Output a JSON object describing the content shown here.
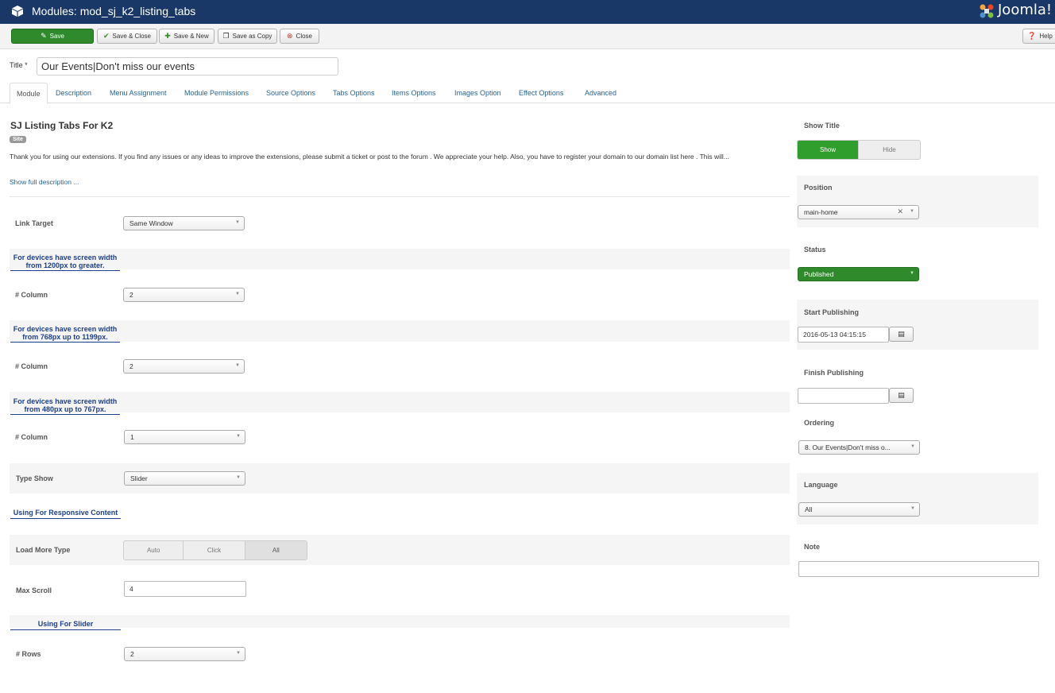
{
  "header": {
    "title": "Modules: mod_sj_k2_listing_tabs",
    "logo_text": "Joomla!"
  },
  "toolbar": {
    "save_label": "Save",
    "save_close_label": "Save & Close",
    "save_new_label": "Save & New",
    "save_copy_label": "Save as Copy",
    "close_label": "Close",
    "help_label": "Help"
  },
  "title_field": {
    "label": "Title *",
    "value": "Our Events|Don't miss our events"
  },
  "tabs": [
    {
      "label": "Module"
    },
    {
      "label": "Description"
    },
    {
      "label": "Menu Assignment"
    },
    {
      "label": "Module Permissions"
    },
    {
      "label": "Source Options"
    },
    {
      "label": "Tabs Options"
    },
    {
      "label": "Items Options"
    },
    {
      "label": "Images Option"
    },
    {
      "label": "Effect Options"
    },
    {
      "label": "Advanced"
    }
  ],
  "module": {
    "heading": "SJ Listing Tabs For K2",
    "badge": "Site",
    "description": "Thank you for using our extensions. If you find any issues or any ideas to improve the extensions, please submit a ticket or post to the forum . We appreciate your help. Also, you have to register your domain to our domain list here . This will...",
    "show_full": "Show full description ..."
  },
  "fields": {
    "link_target": {
      "label": "Link Target",
      "value": "Same Window"
    },
    "spacer_1200": "For devices have screen width from 1200px to greater.",
    "column_1200": {
      "label": "# Column",
      "value": "2"
    },
    "spacer_768": "For devices have screen width from 768px up to 1199px.",
    "column_768": {
      "label": "# Column",
      "value": "2"
    },
    "spacer_480": "For devices have screen width from 480px up to 767px.",
    "column_480": {
      "label": "# Column",
      "value": "1"
    },
    "type_show": {
      "label": "Type Show",
      "value": "Slider"
    },
    "spacer_responsive": "Using For Responsive Content",
    "load_more_type": {
      "label": "Load More Type",
      "options": [
        "Auto",
        "Click",
        "All"
      ],
      "selected": "All"
    },
    "max_scroll": {
      "label": "Max Scroll",
      "value": "4"
    },
    "spacer_slider": "Using For Slider",
    "rows": {
      "label": "# Rows",
      "value": "2"
    }
  },
  "sidebar": {
    "show_title": {
      "label": "Show Title",
      "options": [
        "Show",
        "Hide"
      ],
      "selected": "Show"
    },
    "position": {
      "label": "Position",
      "value": "main-home"
    },
    "status": {
      "label": "Status",
      "value": "Published"
    },
    "start_publishing": {
      "label": "Start Publishing",
      "value": "2016-05-13 04:15:15"
    },
    "finish_publishing": {
      "label": "Finish Publishing",
      "value": ""
    },
    "ordering": {
      "label": "Ordering",
      "value": "8. Our Events|Don't miss o..."
    },
    "language": {
      "label": "Language",
      "value": "All"
    },
    "note": {
      "label": "Note",
      "value": ""
    }
  },
  "colors": {
    "header_bg": "#1a3867",
    "save_green": "#2f8a2c",
    "link_blue": "#2a6496",
    "spacer_blue": "#1d3f8c",
    "status_green": "#2f8a2c"
  }
}
